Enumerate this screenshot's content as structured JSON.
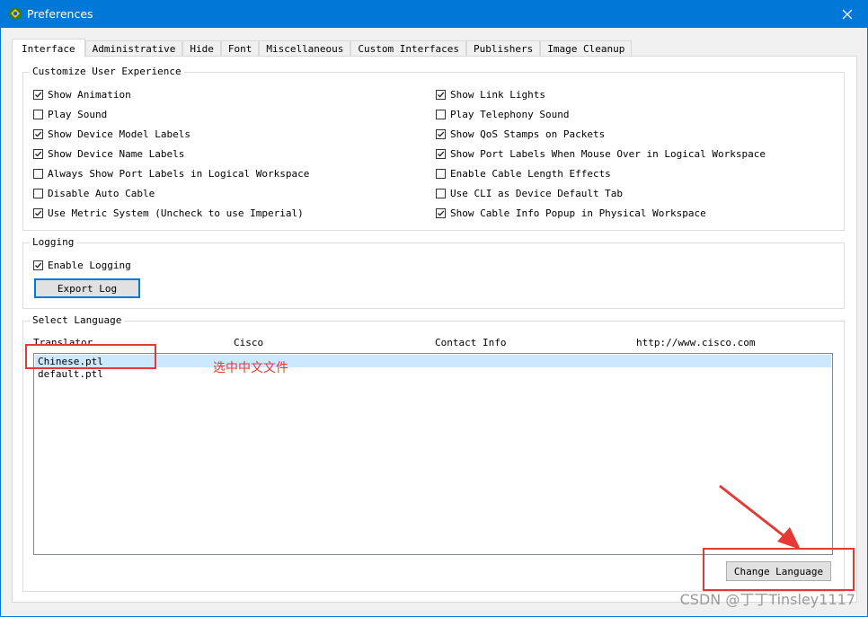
{
  "window": {
    "title": "Preferences",
    "close_icon": "close-icon"
  },
  "tabs": [
    {
      "label": "Interface",
      "active": true
    },
    {
      "label": "Administrative"
    },
    {
      "label": "Hide"
    },
    {
      "label": "Font"
    },
    {
      "label": "Miscellaneous"
    },
    {
      "label": "Custom Interfaces"
    },
    {
      "label": "Publishers"
    },
    {
      "label": "Image Cleanup"
    }
  ],
  "customize": {
    "title": "Customize User Experience",
    "left": [
      {
        "label": "Show Animation",
        "checked": true
      },
      {
        "label": "Play Sound",
        "checked": false
      },
      {
        "label": "Show Device Model Labels",
        "checked": true
      },
      {
        "label": "Show Device Name Labels",
        "checked": true
      },
      {
        "label": "Always Show Port Labels in Logical Workspace",
        "checked": false
      },
      {
        "label": "Disable Auto Cable",
        "checked": false
      },
      {
        "label": "Use Metric System (Uncheck to use Imperial)",
        "checked": true
      }
    ],
    "right": [
      {
        "label": "Show Link Lights",
        "checked": true
      },
      {
        "label": "Play Telephony Sound",
        "checked": false
      },
      {
        "label": "Show QoS Stamps on Packets",
        "checked": true
      },
      {
        "label": "Show Port Labels When Mouse Over in Logical Workspace",
        "checked": true
      },
      {
        "label": "Enable Cable Length Effects",
        "checked": false
      },
      {
        "label": "Use CLI as Device Default Tab",
        "checked": false
      },
      {
        "label": "Show Cable Info Popup in Physical Workspace",
        "checked": true
      }
    ]
  },
  "logging": {
    "title": "Logging",
    "enable_label": "Enable Logging",
    "enable_checked": true,
    "export_button": "Export Log"
  },
  "language": {
    "title": "Select Language",
    "columns": [
      "Translator",
      "Cisco",
      "Contact Info",
      "http://www.cisco.com"
    ],
    "files": [
      {
        "name": "Chinese.ptl",
        "selected": true
      },
      {
        "name": "default.ptl",
        "selected": false
      }
    ],
    "change_button": "Change Language"
  },
  "annotation": {
    "text": "选中中文文件",
    "color": "#e53935"
  },
  "watermark": "CSDN @丁丁Tinsley1117"
}
